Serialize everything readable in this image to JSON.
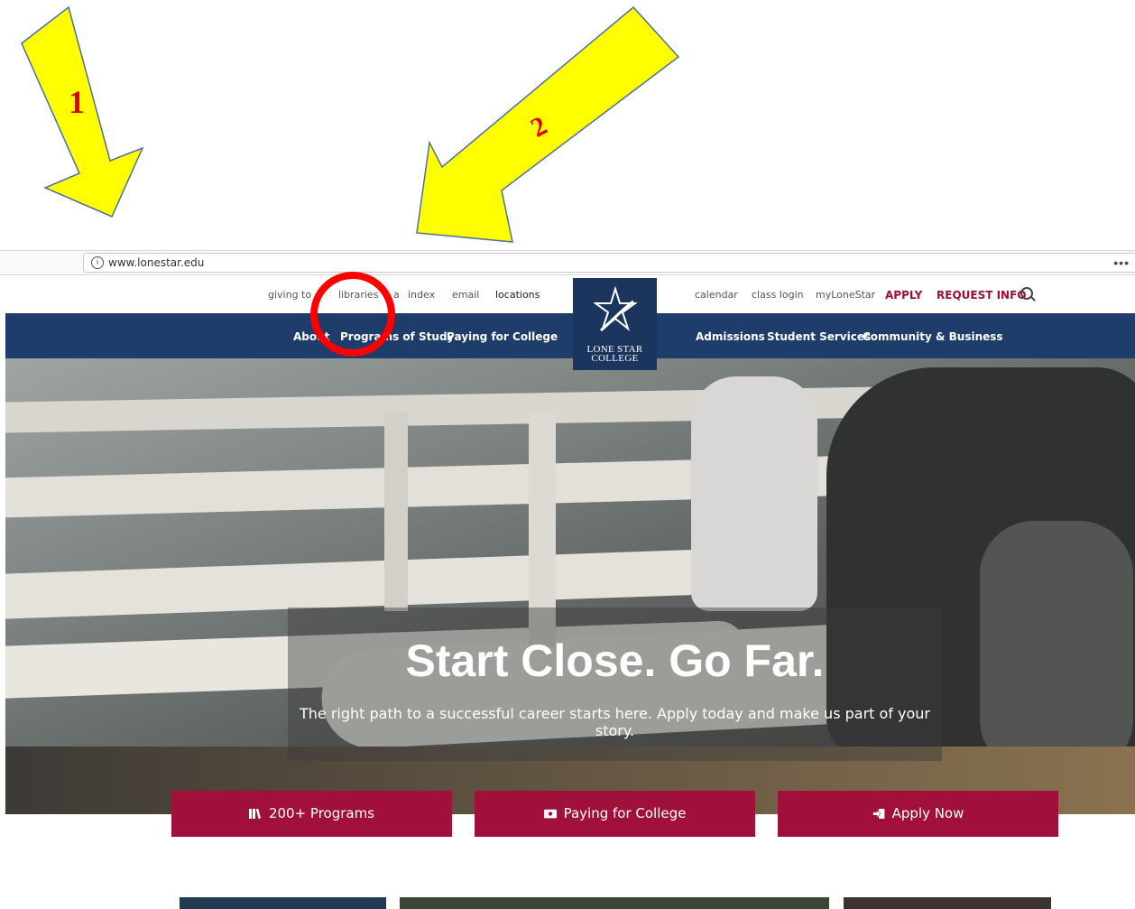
{
  "annotations": {
    "arrow_1_label": "1",
    "arrow_2_label": "2"
  },
  "browser": {
    "url": "www.lonestar.edu",
    "menu": "•••"
  },
  "utility_nav": {
    "left": [
      "giving to",
      "libraries",
      "a",
      "index",
      "email",
      "locations"
    ],
    "right": [
      "calendar",
      "class login",
      "myLoneStar"
    ],
    "apply": "APPLY",
    "request_info": "REQUEST INFO"
  },
  "main_nav": {
    "items": [
      "About",
      "Programs of Study",
      "Paying for College",
      "Admissions",
      "Student Services",
      "Community & Business"
    ]
  },
  "logo": {
    "line1": "LONE STAR",
    "line2": "COLLEGE"
  },
  "hero": {
    "title": "Start Close. Go Far.",
    "subtitle": "The right path to a successful career starts here. Apply today and make us part of your story."
  },
  "cta": {
    "programs": "200+ Programs",
    "paying": "Paying for College",
    "apply": "Apply Now"
  },
  "colors": {
    "navy": "#1f3d6b",
    "maroon": "#a10f3b",
    "annotation_yellow": "#ffff00",
    "annotation_red": "#ff0000"
  }
}
